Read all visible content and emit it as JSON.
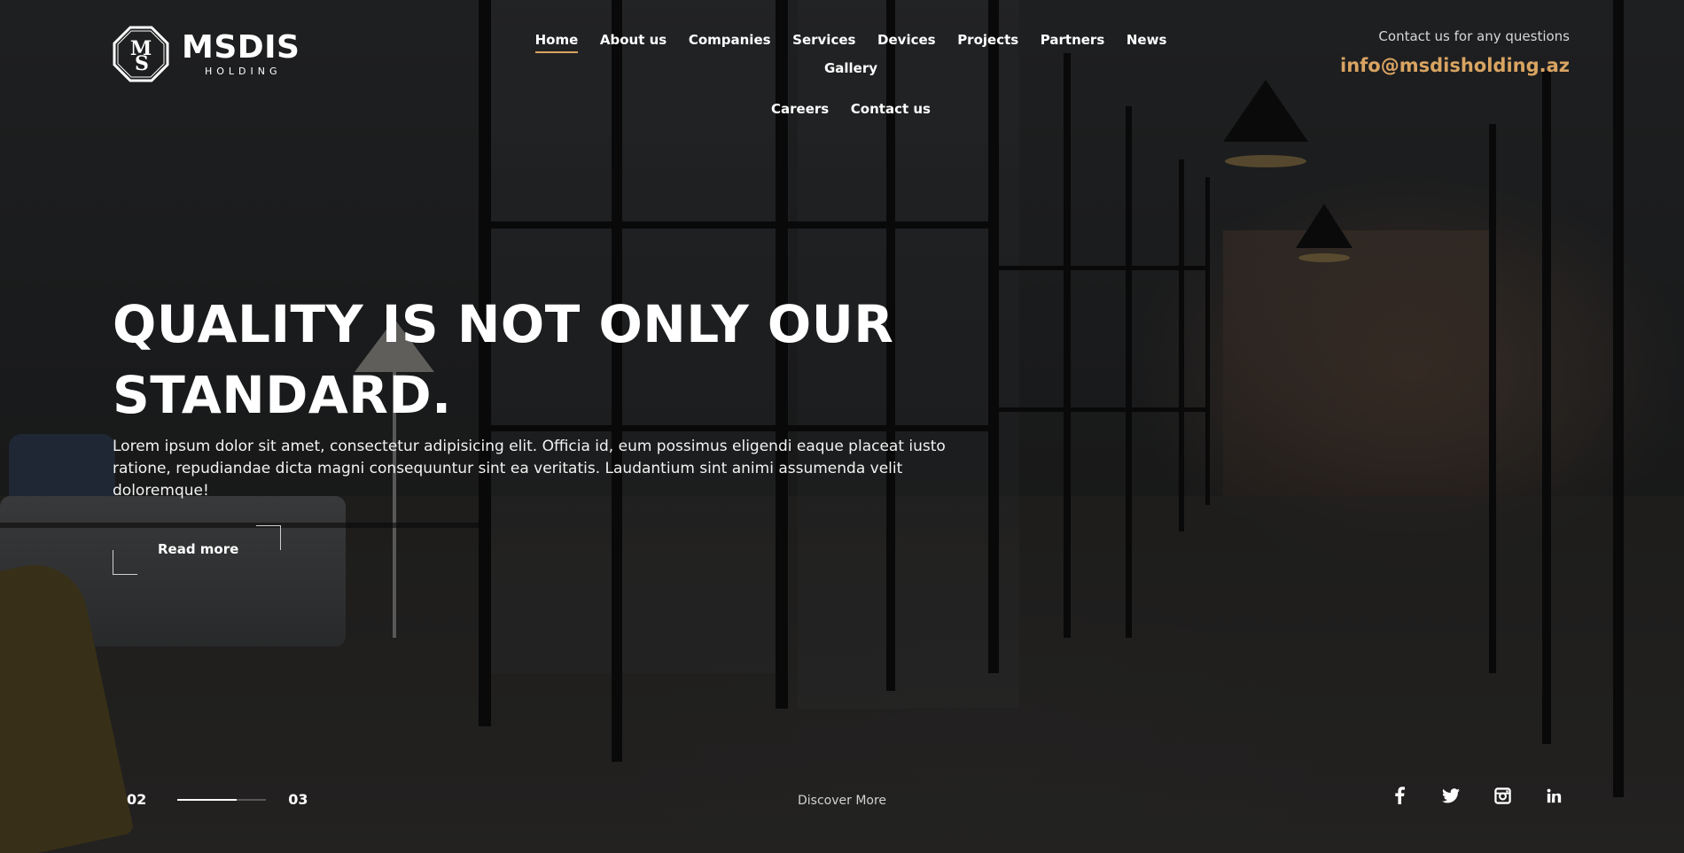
{
  "brand": {
    "name": "MSDIS",
    "sub": "HOLDING"
  },
  "nav": {
    "items": [
      {
        "label": "Home",
        "active": true
      },
      {
        "label": "About us"
      },
      {
        "label": "Companies"
      },
      {
        "label": "Services"
      },
      {
        "label": "Devices"
      },
      {
        "label": "Projects"
      },
      {
        "label": "Partners"
      },
      {
        "label": "News"
      },
      {
        "label": "Gallery"
      },
      {
        "label": "Careers"
      },
      {
        "label": "Contact us"
      }
    ]
  },
  "contact": {
    "label": "Contact us for any questions",
    "email": "info@msdisholding.az"
  },
  "hero": {
    "title_line1": "QUALITY IS NOT ONLY OUR",
    "title_line2": "STANDARD.",
    "text": "Lorem ipsum dolor sit amet, consectetur adipisicing elit. Officia id, eum possimus eligendi eaque placeat iusto ratione, repudiandae dicta magni consequuntur sint ea veritatis. Laudantium sint animi assumenda velit doloremque!",
    "button": "Read more"
  },
  "slider": {
    "current": "02",
    "total": "03",
    "progress": 0.67
  },
  "discover": "Discover More",
  "social": [
    "facebook-icon",
    "twitter-icon",
    "instagram-icon",
    "linkedin-icon"
  ],
  "colors": {
    "accent": "#d9a462",
    "overlay": "rgba(0,0,0,0.48)"
  }
}
